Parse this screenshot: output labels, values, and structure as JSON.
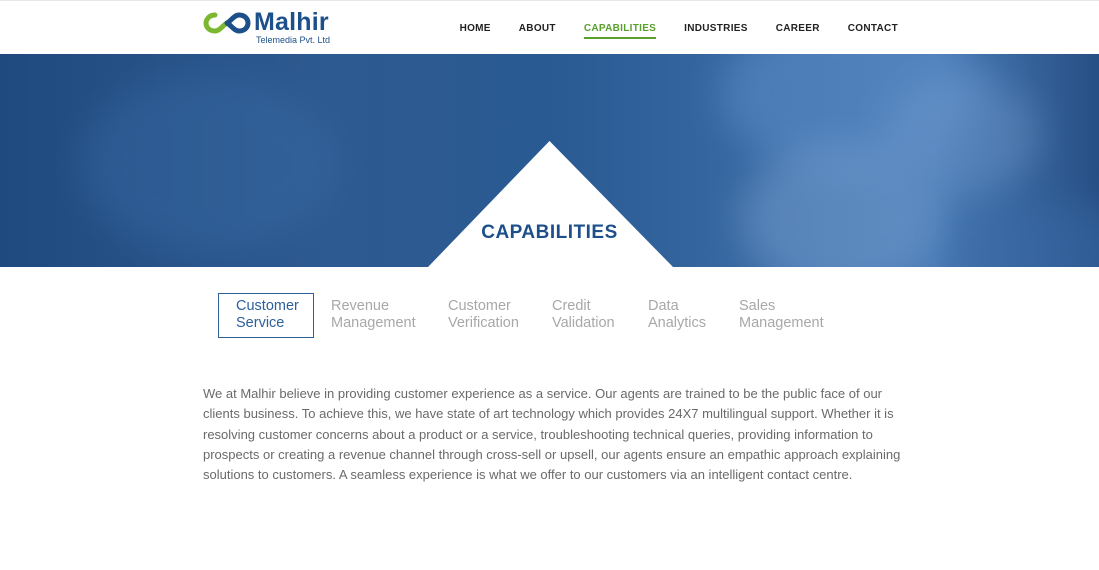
{
  "brand": {
    "name": "Malhir",
    "subtitle": "Telemedia Pvt. Ltd",
    "colors": {
      "primary": "#1d4f8a",
      "accent": "#5aa02c",
      "hero": "#2a5a92"
    }
  },
  "nav": {
    "items": [
      {
        "label": "HOME",
        "active": false
      },
      {
        "label": "ABOUT",
        "active": false
      },
      {
        "label": "CAPABILITIES",
        "active": true
      },
      {
        "label": "INDUSTRIES",
        "active": false
      },
      {
        "label": "CAREER",
        "active": false
      },
      {
        "label": "CONTACT",
        "active": false
      }
    ]
  },
  "hero": {
    "title": "CAPABILITIES"
  },
  "tabs": [
    {
      "line1": "Customer",
      "line2": "Service",
      "active": true
    },
    {
      "line1": "Revenue",
      "line2": "Management",
      "active": false
    },
    {
      "line1": "Customer",
      "line2": "Verification",
      "active": false
    },
    {
      "line1": "Credit",
      "line2": "Validation",
      "active": false
    },
    {
      "line1": "Data",
      "line2": "Analytics",
      "active": false
    },
    {
      "line1": "Sales",
      "line2": "Management",
      "active": false
    }
  ],
  "content": {
    "paragraph": "We at Malhir believe in providing customer experience as a service. Our agents are trained to be the public face of our clients business. To achieve this, we have state of art technology which provides 24X7 multilingual support. Whether it is resolving customer concerns about a product or a service, troubleshooting technical queries, providing information to prospects or creating a revenue channel through cross-sell or upsell, our agents ensure an empathic approach explaining solutions to customers. A seamless experience is what we offer to our customers via an intelligent contact centre."
  }
}
